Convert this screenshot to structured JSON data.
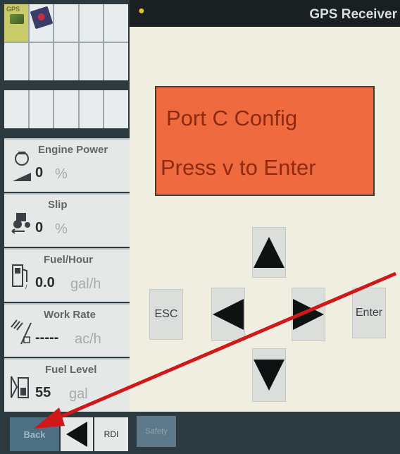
{
  "window": {
    "title": "GPS Receiver"
  },
  "shortcuts": {
    "gps_label": "GPS"
  },
  "gauges": [
    {
      "label": "Engine Power",
      "value": "0",
      "unit": "%",
      "icon": "engine-icon"
    },
    {
      "label": "Slip",
      "value": "0",
      "unit": "%",
      "icon": "tractor-slip-icon"
    },
    {
      "label": "Fuel/Hour",
      "value": "0.0",
      "unit": "gal/h",
      "icon": "fuel-pump-icon"
    },
    {
      "label": "Work Rate",
      "value": "-----",
      "unit": "ac/h",
      "icon": "work-rate-icon"
    },
    {
      "label": "Fuel Level",
      "value": "55",
      "unit": "gal",
      "icon": "fuel-level-icon"
    }
  ],
  "display": {
    "line1": "Port C Config",
    "line2": "Press v to Enter"
  },
  "keypad": {
    "esc_label": "ESC",
    "enter_label": "Enter"
  },
  "bottom": {
    "back_label": "Back",
    "rdi_label": "RDI",
    "safety_label": "Safety"
  },
  "colors": {
    "lcd": "#f06a3f",
    "lcd_text": "#8e2a12",
    "annotation_arrow": "#d01818",
    "back_button": "#4d6f84"
  }
}
